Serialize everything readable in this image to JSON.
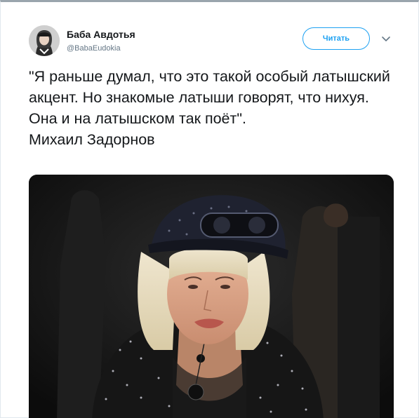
{
  "author": {
    "display_name": "Баба Авдотья",
    "handle": "@BabaEudokia"
  },
  "actions": {
    "follow_label": "Читать",
    "menu_icon": "chevron-down-icon"
  },
  "tweet": {
    "text": "\"Я раньше думал, что это такой особый латышский акцент. Но знакомые латыши говорят, что нихуя. Она и на латышском так поёт\".\nМихаил Задорнов"
  },
  "colors": {
    "accent": "#1da1f2",
    "text": "#14171a",
    "muted": "#657786"
  }
}
